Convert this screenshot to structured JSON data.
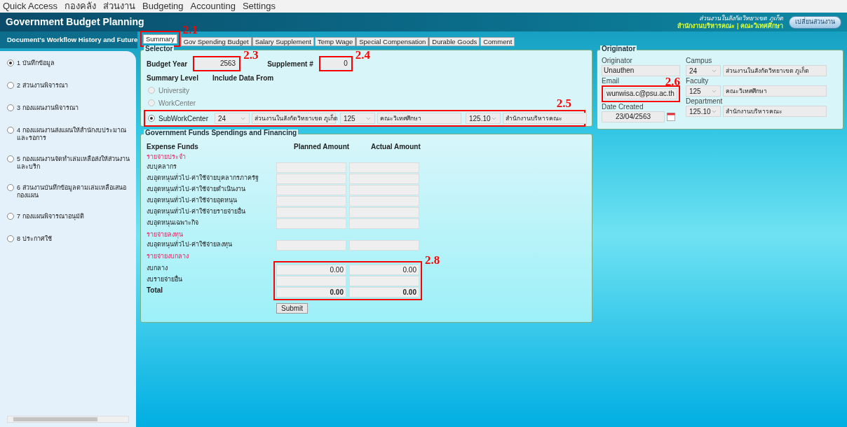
{
  "menu": [
    "Quick Access",
    "กองคลัง",
    "ส่วนงาน",
    "Budgeting",
    "Accounting",
    "Settings"
  ],
  "header": {
    "title": "Government Budget Planning",
    "unit_line": "ส่วนงานในสังกัดวิทยาเขต ภูเก็ต",
    "org_line": "สำนักงานบริหารคณะ | คณะวิเทศศึกษา",
    "switch_button": "เปลี่ยนส่วนงาน"
  },
  "sidebar": {
    "title": "Document's Workflow History and Future",
    "steps": [
      {
        "label": "1 บันทึกข้อมูล",
        "selected": true
      },
      {
        "label": "2 ส่วนงานพิจารณา",
        "selected": false
      },
      {
        "label": "3 กองแผนงานพิจารณา",
        "selected": false
      },
      {
        "label": "4 กองแผนงานส่งแผนให้สำนักงบประมาณและรอการ",
        "selected": false
      },
      {
        "label": "5 กองแผนงานจัดทำเล่มเหลือส่งให้ส่วนงานและบริก",
        "selected": false
      },
      {
        "label": "6 ส่วนงานบันทึกข้อมูลตามเล่มเหลือเสนอกองแผน",
        "selected": false
      },
      {
        "label": "7 กองแผนพิจารณาอนุมัติ",
        "selected": false
      },
      {
        "label": "8 ประกาศใช้",
        "selected": false
      }
    ]
  },
  "tabs": [
    {
      "label": "Summary",
      "selected": true,
      "annotation": "2.1"
    },
    {
      "label": "Gov Spending Budget",
      "selected": false
    },
    {
      "label": "Salary Supplement",
      "selected": false
    },
    {
      "label": "Temp Wage",
      "selected": false
    },
    {
      "label": "Special Compensation",
      "selected": false
    },
    {
      "label": "Durable Goods",
      "selected": false
    },
    {
      "label": "Comment",
      "selected": false
    }
  ],
  "selector": {
    "title": "Selector",
    "budget_year": {
      "label": "Budget Year",
      "value": "2563",
      "annotation": "2.3"
    },
    "supplement": {
      "label": "Supplement #",
      "value": "0",
      "annotation": "2.4"
    },
    "summary_level_label": "Summary Level",
    "include_label": "Include Data From",
    "levels": [
      {
        "label": "University",
        "selected": false,
        "disabled": true
      },
      {
        "label": "WorkCenter",
        "selected": false,
        "disabled": true
      },
      {
        "label": "SubWorkCenter",
        "selected": true,
        "disabled": false,
        "annotation": "2.5",
        "combos": [
          {
            "code": "24",
            "name": "ส่วนงานในสังกัดวิทยาเขต ภูเก็ต"
          },
          {
            "code": "125",
            "name": "คณะวิเทศศึกษา"
          },
          {
            "code": "125.10",
            "name": "สำนักงานบริหารคณะ"
          }
        ]
      }
    ]
  },
  "originator": {
    "title": "Originator",
    "left": [
      {
        "label": "Originator",
        "value": "Unauthen"
      },
      {
        "label": "Email",
        "value": "wunwisa.c@psu.ac.th",
        "annotation": "2.6"
      },
      {
        "label": "Date Created",
        "value": "23/04/2563",
        "kind": "date"
      }
    ],
    "right": [
      {
        "label": "Campus",
        "code": "24",
        "name": "ส่วนงานในสังกัดวิทยาเขต ภูเก็ต"
      },
      {
        "label": "Faculty",
        "code": "125",
        "name": "คณะวิเทศศึกษา"
      },
      {
        "label": "Department",
        "code": "125.10",
        "name": "สำนักงานบริหารคณะ"
      }
    ]
  },
  "funds": {
    "title": "Government Funds Spendings and Financing",
    "columns": [
      "Expense Funds",
      "Planned Amount",
      "Actual Amount"
    ],
    "rows": [
      {
        "kind": "section",
        "label": "รายจ่ายประจำ"
      },
      {
        "kind": "item",
        "label": "งบบุคลากร"
      },
      {
        "kind": "item",
        "label": "งบอุดหนุนทั่วไป-ค่าใช้จ่ายบุคลากรภาครัฐ"
      },
      {
        "kind": "item",
        "label": "งบอุดหนุนทั่วไป-ค่าใช้จ่ายดำเนินงาน"
      },
      {
        "kind": "item",
        "label": "งบอุดหนุนทั่วไป-ค่าใช้จ่ายอุดหนุน"
      },
      {
        "kind": "item",
        "label": "งบอุดหนุนทั่วไป-ค่าใช้จ่ายรายจ่ายอื่น"
      },
      {
        "kind": "item",
        "label": "งบอุดหนุนเฉพาะกิจ"
      },
      {
        "kind": "section",
        "label": "รายจ่ายลงทุน"
      },
      {
        "kind": "item",
        "label": "งบอุดหนุนทั่วไป-ค่าใช้จ่ายลงทุน"
      },
      {
        "kind": "section",
        "label": "รายจ่ายงบกลาง"
      }
    ],
    "highlight": {
      "annotation": "2.8",
      "rows": [
        {
          "kind": "item",
          "label": "งบกลาง",
          "planned": "0.00",
          "actual": "0.00"
        },
        {
          "kind": "item",
          "label": "งบรายจ่ายอื่น"
        },
        {
          "kind": "total",
          "label": "Total",
          "planned": "0.00",
          "actual": "0.00"
        }
      ]
    },
    "submit": "Submit"
  }
}
